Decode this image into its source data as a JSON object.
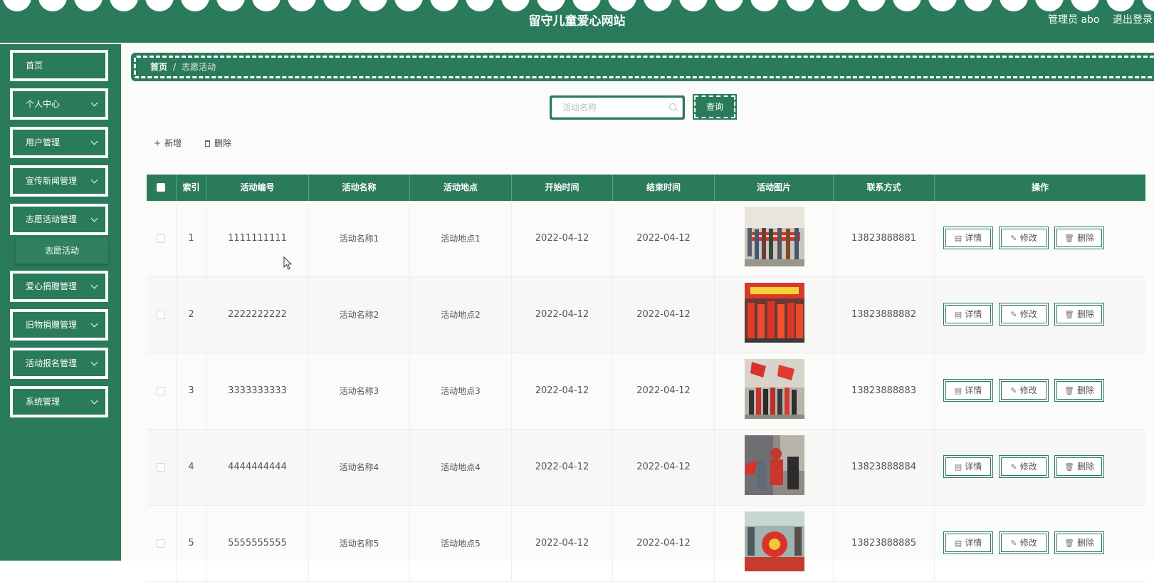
{
  "header": {
    "title": "留守儿童爱心网站",
    "user": "管理员 abo",
    "logout": "退出登录"
  },
  "sidebar": {
    "items": [
      {
        "label": "首页",
        "has_children": false
      },
      {
        "label": "个人中心",
        "has_children": true
      },
      {
        "label": "用户管理",
        "has_children": true
      },
      {
        "label": "宣传新闻管理",
        "has_children": true
      },
      {
        "label": "志愿活动管理",
        "has_children": true
      },
      {
        "label": "爱心捐赠管理",
        "has_children": true
      },
      {
        "label": "旧物捐赠管理",
        "has_children": true
      },
      {
        "label": "活动报名管理",
        "has_children": true
      },
      {
        "label": "系统管理",
        "has_children": true
      }
    ],
    "submenu": {
      "label": "志愿活动"
    }
  },
  "breadcrumb": {
    "home": "首页",
    "sep": "/",
    "current": "志愿活动"
  },
  "search": {
    "placeholder": "活动名称",
    "value": "",
    "button": "查询"
  },
  "toolbar": {
    "add": "新增",
    "delete": "删除"
  },
  "table": {
    "headers": [
      "索引",
      "活动编号",
      "活动名称",
      "活动地点",
      "开始时间",
      "结束时间",
      "活动图片",
      "联系方式",
      "操作"
    ],
    "rows": [
      {
        "index": "1",
        "code": "1111111111",
        "name": "活动名称1",
        "place": "活动地点1",
        "start": "2022-04-12",
        "end": "2022-04-12",
        "phone": "13823888881"
      },
      {
        "index": "2",
        "code": "2222222222",
        "name": "活动名称2",
        "place": "活动地点2",
        "start": "2022-04-12",
        "end": "2022-04-12",
        "phone": "13823888882"
      },
      {
        "index": "3",
        "code": "3333333333",
        "name": "活动名称3",
        "place": "活动地点3",
        "start": "2022-04-12",
        "end": "2022-04-12",
        "phone": "13823888883"
      },
      {
        "index": "4",
        "code": "4444444444",
        "name": "活动名称4",
        "place": "活动地点4",
        "start": "2022-04-12",
        "end": "2022-04-12",
        "phone": "13823888884"
      },
      {
        "index": "5",
        "code": "5555555555",
        "name": "活动名称5",
        "place": "活动地点5",
        "start": "2022-04-12",
        "end": "2022-04-12",
        "phone": "13823888885"
      }
    ],
    "actions": {
      "detail": "详情",
      "edit": "修改",
      "delete": "删除"
    }
  },
  "colors": {
    "primary": "#2a7a5c",
    "background": "#fbfbf9"
  }
}
